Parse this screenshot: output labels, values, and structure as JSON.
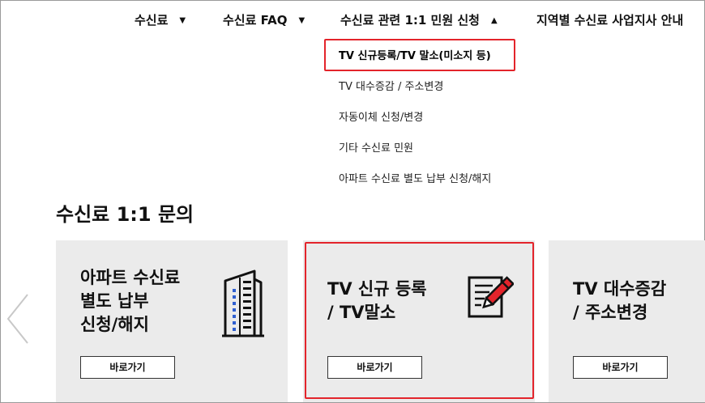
{
  "nav": {
    "items": [
      {
        "label": "수신료",
        "caret": "▼"
      },
      {
        "label": "수신료 FAQ",
        "caret": "▼"
      },
      {
        "label": "수신료 관련 1:1 민원 신청",
        "caret": "▲"
      },
      {
        "label": "지역별 수신료 사업지사 안내"
      }
    ]
  },
  "dropdown": {
    "items": [
      "TV 신규등록/TV 말소(미소지 등)",
      "TV 대수증감 / 주소변경",
      "자동이체 신청/변경",
      "기타 수신료 민원",
      "아파트 수신료 별도 납부 신청/해지"
    ]
  },
  "section": {
    "title": "수신료 1:1 문의"
  },
  "cards": [
    {
      "title_lines": [
        "아파트 수신료",
        "별도 납부",
        "신청/해지"
      ],
      "button": "바로가기",
      "icon": "apartment-building-icon"
    },
    {
      "title_lines": [
        "TV 신규 등록",
        "/ TV말소"
      ],
      "button": "바로가기",
      "icon": "document-pencil-icon"
    },
    {
      "title_lines": [
        "TV 대수증감",
        "/ 주소변경"
      ],
      "button": "바로가기"
    }
  ],
  "colors": {
    "highlight": "#e3242b",
    "card_bg": "#ebebeb",
    "building_windows": "#2f5fd0"
  }
}
